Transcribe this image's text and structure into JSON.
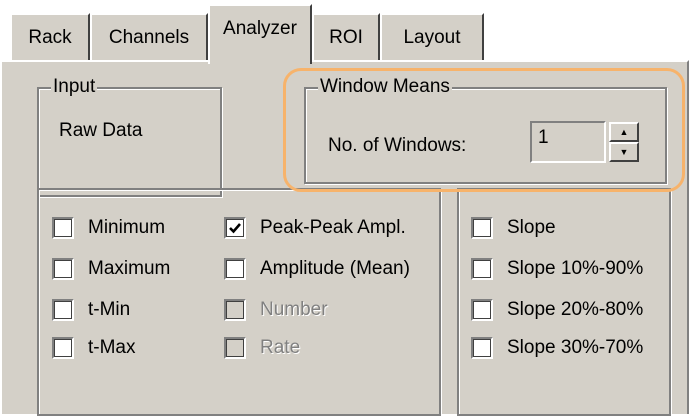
{
  "tabs": [
    {
      "label": "Rack",
      "active": false
    },
    {
      "label": "Channels",
      "active": false
    },
    {
      "label": "Analyzer",
      "active": true
    },
    {
      "label": "ROI",
      "active": false
    },
    {
      "label": "Layout",
      "active": false
    }
  ],
  "input_group": {
    "title": "Input",
    "value": "Raw Data"
  },
  "window_means": {
    "title": "Window Means",
    "label": "No. of Windows:",
    "value": "1"
  },
  "measurements_left": [
    {
      "label": "Minimum",
      "checked": false,
      "enabled": true
    },
    {
      "label": "Maximum",
      "checked": false,
      "enabled": true
    },
    {
      "label": "t-Min",
      "checked": false,
      "enabled": true
    },
    {
      "label": "t-Max",
      "checked": false,
      "enabled": true
    }
  ],
  "measurements_middle": [
    {
      "label": "Peak-Peak Ampl.",
      "checked": true,
      "enabled": true
    },
    {
      "label": "Amplitude (Mean)",
      "checked": false,
      "enabled": true
    },
    {
      "label": "Number",
      "checked": false,
      "enabled": false
    },
    {
      "label": "Rate",
      "checked": false,
      "enabled": false
    }
  ],
  "measurements_slope": [
    {
      "label": "Slope",
      "checked": false,
      "enabled": true
    },
    {
      "label": "Slope 10%-90%",
      "checked": false,
      "enabled": true
    },
    {
      "label": "Slope 20%-80%",
      "checked": false,
      "enabled": true
    },
    {
      "label": "Slope 30%-70%",
      "checked": false,
      "enabled": true
    }
  ],
  "colors": {
    "face": "#d4d0c8",
    "highlight": "#f7b36b",
    "disabled_text": "#808080"
  }
}
